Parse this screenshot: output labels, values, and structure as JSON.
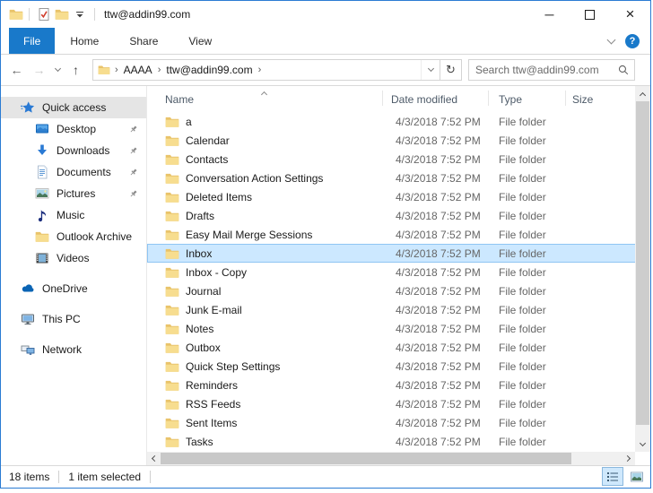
{
  "colors": {
    "accent_border": "#2b7cd3",
    "file_tab_blue": "#1979ca",
    "selection_bg": "#cce8ff",
    "selection_border": "#8fc5f3",
    "quick_access_selected_bg": "#e5e5e5",
    "folder_yellow": "#f7dd8f"
  },
  "titlebar": {
    "title": "ttw@addin99.com",
    "qat": [
      {
        "icon": "properties-check-icon"
      },
      {
        "icon": "new-folder-icon"
      },
      {
        "icon": "customize-qat-icon"
      }
    ]
  },
  "glyphs": {
    "back": "←",
    "forward": "→",
    "up": "↑",
    "refresh": "↻",
    "minimize": "─",
    "close": "×",
    "crumb_sep": "›"
  },
  "ribbon": {
    "tabs": [
      {
        "label": "File",
        "active": true
      },
      {
        "label": "Home",
        "active": false
      },
      {
        "label": "Share",
        "active": false
      },
      {
        "label": "View",
        "active": false
      }
    ],
    "help_label": "?"
  },
  "addressbar": {
    "breadcrumb": [
      "AAAA",
      "ttw@addin99.com"
    ],
    "search_placeholder": "Search ttw@addin99.com"
  },
  "sidebar": {
    "items": [
      {
        "label": "Quick access",
        "icon": "quick-access-star-icon",
        "level": 1,
        "selected": true,
        "pinned": false,
        "section_gap": false
      },
      {
        "label": "Desktop",
        "icon": "desktop-icon",
        "level": 2,
        "selected": false,
        "pinned": true,
        "section_gap": false
      },
      {
        "label": "Downloads",
        "icon": "downloads-icon",
        "level": 2,
        "selected": false,
        "pinned": true,
        "section_gap": false
      },
      {
        "label": "Documents",
        "icon": "documents-icon",
        "level": 2,
        "selected": false,
        "pinned": true,
        "section_gap": false
      },
      {
        "label": "Pictures",
        "icon": "pictures-icon",
        "level": 2,
        "selected": false,
        "pinned": true,
        "section_gap": false
      },
      {
        "label": "Music",
        "icon": "music-icon",
        "level": 2,
        "selected": false,
        "pinned": false,
        "section_gap": false
      },
      {
        "label": "Outlook Archive",
        "icon": "folder-icon",
        "level": 2,
        "selected": false,
        "pinned": false,
        "section_gap": false
      },
      {
        "label": "Videos",
        "icon": "videos-icon",
        "level": 2,
        "selected": false,
        "pinned": false,
        "section_gap": false
      },
      {
        "label": "OneDrive",
        "icon": "onedrive-icon",
        "level": 1,
        "selected": false,
        "pinned": false,
        "section_gap": true
      },
      {
        "label": "This PC",
        "icon": "this-pc-icon",
        "level": 1,
        "selected": false,
        "pinned": false,
        "section_gap": true
      },
      {
        "label": "Network",
        "icon": "network-icon",
        "level": 1,
        "selected": false,
        "pinned": false,
        "section_gap": true
      }
    ]
  },
  "filelist": {
    "columns": [
      "Name",
      "Date modified",
      "Type",
      "Size"
    ],
    "rows": [
      {
        "name": "a",
        "date": "4/3/2018 7:52 PM",
        "type": "File folder",
        "size": "",
        "selected": false
      },
      {
        "name": "Calendar",
        "date": "4/3/2018 7:52 PM",
        "type": "File folder",
        "size": "",
        "selected": false
      },
      {
        "name": "Contacts",
        "date": "4/3/2018 7:52 PM",
        "type": "File folder",
        "size": "",
        "selected": false
      },
      {
        "name": "Conversation Action Settings",
        "date": "4/3/2018 7:52 PM",
        "type": "File folder",
        "size": "",
        "selected": false
      },
      {
        "name": "Deleted Items",
        "date": "4/3/2018 7:52 PM",
        "type": "File folder",
        "size": "",
        "selected": false
      },
      {
        "name": "Drafts",
        "date": "4/3/2018 7:52 PM",
        "type": "File folder",
        "size": "",
        "selected": false
      },
      {
        "name": "Easy Mail Merge Sessions",
        "date": "4/3/2018 7:52 PM",
        "type": "File folder",
        "size": "",
        "selected": false
      },
      {
        "name": "Inbox",
        "date": "4/3/2018 7:52 PM",
        "type": "File folder",
        "size": "",
        "selected": true
      },
      {
        "name": "Inbox - Copy",
        "date": "4/3/2018 7:52 PM",
        "type": "File folder",
        "size": "",
        "selected": false
      },
      {
        "name": "Journal",
        "date": "4/3/2018 7:52 PM",
        "type": "File folder",
        "size": "",
        "selected": false
      },
      {
        "name": "Junk E-mail",
        "date": "4/3/2018 7:52 PM",
        "type": "File folder",
        "size": "",
        "selected": false
      },
      {
        "name": "Notes",
        "date": "4/3/2018 7:52 PM",
        "type": "File folder",
        "size": "",
        "selected": false
      },
      {
        "name": "Outbox",
        "date": "4/3/2018 7:52 PM",
        "type": "File folder",
        "size": "",
        "selected": false
      },
      {
        "name": "Quick Step Settings",
        "date": "4/3/2018 7:52 PM",
        "type": "File folder",
        "size": "",
        "selected": false
      },
      {
        "name": "Reminders",
        "date": "4/3/2018 7:52 PM",
        "type": "File folder",
        "size": "",
        "selected": false
      },
      {
        "name": "RSS Feeds",
        "date": "4/3/2018 7:52 PM",
        "type": "File folder",
        "size": "",
        "selected": false
      },
      {
        "name": "Sent Items",
        "date": "4/3/2018 7:52 PM",
        "type": "File folder",
        "size": "",
        "selected": false
      },
      {
        "name": "Tasks",
        "date": "4/3/2018 7:52 PM",
        "type": "File folder",
        "size": "",
        "selected": false
      }
    ]
  },
  "statusbar": {
    "items_count": "18 items",
    "selected_count": "1 item selected",
    "view_buttons": [
      {
        "icon": "details-view-icon",
        "selected": true
      },
      {
        "icon": "thumbnail-view-icon",
        "selected": false
      }
    ]
  }
}
